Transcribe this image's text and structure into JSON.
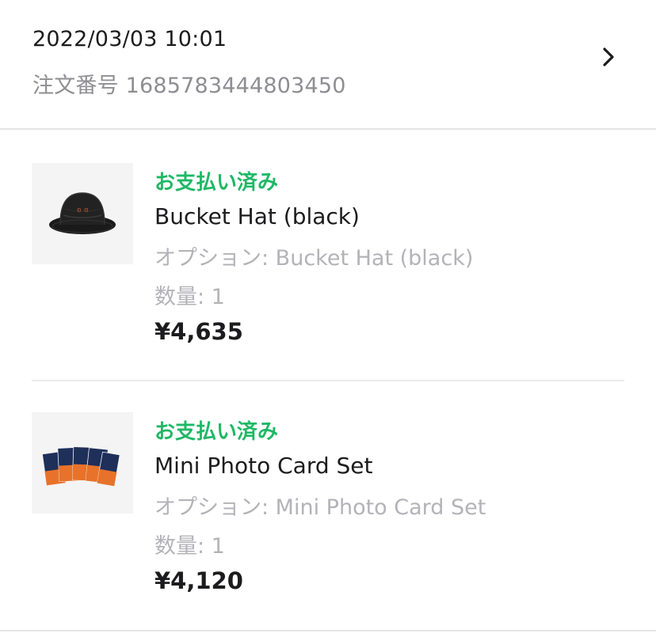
{
  "order": {
    "date": "2022/03/03 10:01",
    "number": "注文番号 1685783444803450"
  },
  "icons": {
    "chevron": "chevron-right-icon"
  },
  "colors": {
    "status_green": "#1fb866",
    "primary_text": "#1c1c1e",
    "secondary_text": "#b3b3b8"
  },
  "items": [
    {
      "status": "お支払い済み",
      "name": "Bucket Hat (black)",
      "option": "オプション: Bucket Hat (black)",
      "quantity": "数量: 1",
      "price": "¥4,635"
    },
    {
      "status": "お支払い済み",
      "name": "Mini Photo Card Set",
      "option": "オプション: Mini Photo Card Set",
      "quantity": "数量: 1",
      "price": "¥4,120"
    }
  ]
}
